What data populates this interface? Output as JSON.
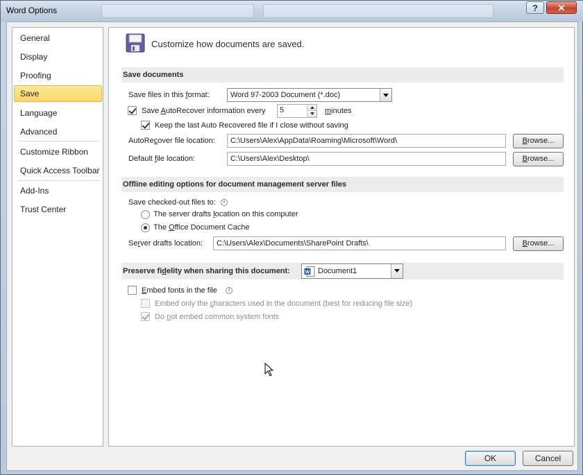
{
  "window": {
    "title": "Word Options",
    "help_glyph": "?",
    "close_glyph": "✕"
  },
  "nav": {
    "items": [
      {
        "label": "General",
        "active": false
      },
      {
        "label": "Display",
        "active": false
      },
      {
        "label": "Proofing",
        "active": false
      },
      {
        "label": "Save",
        "active": true
      },
      {
        "label": "Language",
        "active": false
      },
      {
        "label": "Advanced",
        "active": false
      },
      {
        "label": "Customize Ribbon",
        "active": false
      },
      {
        "label": "Quick Access Toolbar",
        "active": false
      },
      {
        "label": "Add-Ins",
        "active": false
      },
      {
        "label": "Trust Center",
        "active": false
      }
    ]
  },
  "header": {
    "icon": "floppy-disk-icon",
    "title": "Customize how documents are saved."
  },
  "save_documents": {
    "heading": "Save documents",
    "format_label_pre": "Save files in this ",
    "format_label_u": "f",
    "format_label_post": "ormat:",
    "format_value": "Word 97-2003 Document (*.doc)",
    "autorecover_checked": true,
    "autorecover_label_pre": "Save ",
    "autorecover_label_u": "A",
    "autorecover_label_post": "utoRecover information every",
    "autorecover_minutes": "5",
    "minutes_label_u": "m",
    "minutes_label_post": "inutes",
    "keep_last_checked": true,
    "keep_last_label": "Keep the last Auto Recovered file if I close without saving",
    "autorecover_location_label_pre": "AutoRe",
    "autorecover_location_label_u": "c",
    "autorecover_location_label_post": "over file location:",
    "autorecover_location_value": "C:\\Users\\Alex\\AppData\\Roaming\\Microsoft\\Word\\",
    "default_location_label_pre": "Default ",
    "default_location_label_u": "f",
    "default_location_label_post": "ile location:",
    "default_location_value": "C:\\Users\\Alex\\Desktop\\",
    "browse_label_pre": "",
    "browse_label_u": "B",
    "browse_label_post": "rowse..."
  },
  "offline": {
    "heading": "Offline editing options for document management server files",
    "save_checked_out_label": "Save checked-out files to:",
    "radio_server_pre": "The server drafts ",
    "radio_server_u": "l",
    "radio_server_post": "ocation on this computer",
    "radio_server_checked": false,
    "radio_cache_pre": "The ",
    "radio_cache_u": "O",
    "radio_cache_post": "ffice Document Cache",
    "radio_cache_checked": true,
    "server_drafts_label_pre": "Se",
    "server_drafts_label_u": "r",
    "server_drafts_label_post": "ver drafts location:",
    "server_drafts_value": "C:\\Users\\Alex\\Documents\\SharePoint Drafts\\"
  },
  "fidelity": {
    "heading_pre": "Preserve fi",
    "heading_u": "d",
    "heading_post": "elity when sharing this document:",
    "document_value": "Document1",
    "embed_fonts_checked": false,
    "embed_fonts_pre": "",
    "embed_fonts_u": "E",
    "embed_fonts_post": "mbed fonts in the file",
    "embed_only_checked": false,
    "embed_only_pre": "Embed only the ",
    "embed_only_u": "c",
    "embed_only_post": "haracters used in the document (best for reducing file size)",
    "no_common_checked": true,
    "no_common_pre": "Do ",
    "no_common_u": "n",
    "no_common_post": "ot embed common system fonts"
  },
  "footer": {
    "ok_label": "OK",
    "cancel_label": "Cancel"
  }
}
